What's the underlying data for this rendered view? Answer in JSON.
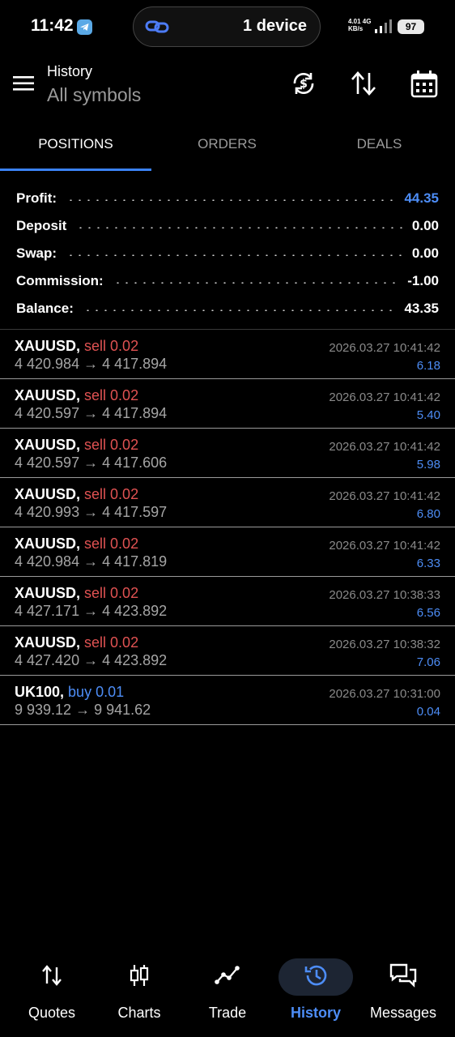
{
  "status": {
    "time": "11:42",
    "pill_text": "1 device",
    "net_line1": "4.01 4G",
    "net_line2": "KB/s",
    "battery": "97"
  },
  "header": {
    "subtitle": "History",
    "title": "All symbols"
  },
  "tabs": [
    {
      "label": "POSITIONS",
      "active": true
    },
    {
      "label": "ORDERS",
      "active": false
    },
    {
      "label": "DEALS",
      "active": false
    }
  ],
  "summary": [
    {
      "label": "Profit:",
      "value": "44.35"
    },
    {
      "label": "Deposit",
      "value": "0.00"
    },
    {
      "label": "Swap:",
      "value": "0.00"
    },
    {
      "label": "Commission:",
      "value": "-1.00"
    },
    {
      "label": "Balance:",
      "value": "43.35"
    }
  ],
  "positions": [
    {
      "symbol": "XAUUSD,",
      "side": "sell 0.02",
      "open": "4 420.984",
      "arrow": "→",
      "close": "4 417.894",
      "time": "2026.03.27 10:41:42",
      "profit": "6.18"
    },
    {
      "symbol": "XAUUSD,",
      "side": "sell 0.02",
      "open": "4 420.597",
      "arrow": "→",
      "close": "4 417.894",
      "time": "2026.03.27 10:41:42",
      "profit": "5.40"
    },
    {
      "symbol": "XAUUSD,",
      "side": "sell 0.02",
      "open": "4 420.597",
      "arrow": "→",
      "close": "4 417.606",
      "time": "2026.03.27 10:41:42",
      "profit": "5.98"
    },
    {
      "symbol": "XAUUSD,",
      "side": "sell 0.02",
      "open": "4 420.993",
      "arrow": "→",
      "close": "4 417.597",
      "time": "2026.03.27 10:41:42",
      "profit": "6.80"
    },
    {
      "symbol": "XAUUSD,",
      "side": "sell 0.02",
      "open": "4 420.984",
      "arrow": "→",
      "close": "4 417.819",
      "time": "2026.03.27 10:41:42",
      "profit": "6.33"
    },
    {
      "symbol": "XAUUSD,",
      "side": "sell 0.02",
      "open": "4 427.171",
      "arrow": "→",
      "close": "4 423.892",
      "time": "2026.03.27 10:38:33",
      "profit": "6.56"
    },
    {
      "symbol": "XAUUSD,",
      "side": "sell 0.02",
      "open": "4 427.420",
      "arrow": "→",
      "close": "4 423.892",
      "time": "2026.03.27 10:38:32",
      "profit": "7.06"
    },
    {
      "symbol": "UK100,",
      "side": "buy 0.01",
      "open": "9 939.12",
      "arrow": "→",
      "close": "9 941.62",
      "time": "2026.03.27 10:31:00",
      "profit": "0.04"
    }
  ],
  "nav": [
    {
      "label": "Quotes",
      "icon": "quotes-arrows-icon"
    },
    {
      "label": "Charts",
      "icon": "candlestick-icon"
    },
    {
      "label": "Trade",
      "icon": "trend-line-icon"
    },
    {
      "label": "History",
      "icon": "history-clock-icon",
      "active": true
    },
    {
      "label": "Messages",
      "icon": "chat-bubbles-icon"
    }
  ],
  "colors": {
    "accent": "#4d8df6",
    "sell": "#e05252",
    "background": "#000000"
  }
}
